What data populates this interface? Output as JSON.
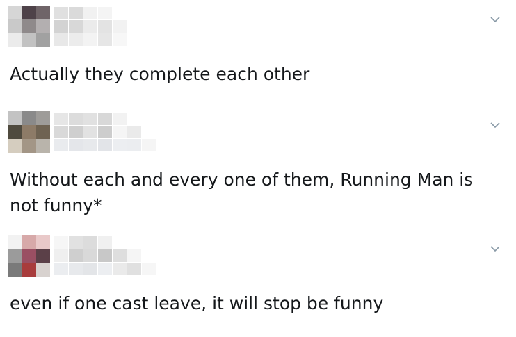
{
  "replies": [
    {
      "text": "Actually they complete each other",
      "avatar_colors": [
        "#d6d6d6",
        "#4e4249",
        "#6f6468",
        "#c9c9c9",
        "#8f8a8b",
        "#b3afb0",
        "#ebebeb",
        "#c2c2c2",
        "#a1a1a1"
      ],
      "name_colors": [
        "#e0e0e0",
        "#dadada",
        "#f1f1f1",
        "#f4f4f4",
        "#ffffff",
        "#d3d3d3",
        "#d8d8d8",
        "#ebebeb",
        "#e3e3e3",
        "#f2f2f2",
        "#e8e8e8",
        "#ececec",
        "#f3f3f3",
        "#e6e6e6",
        "#f7f7f7"
      ]
    },
    {
      "text": "Without each and every one of them, Running Man is not funny*",
      "avatar_colors": [
        "#c3c3c3",
        "#8a8a8a",
        "#9e9c99",
        "#4f4a3e",
        "#8d7b67",
        "#6f6352",
        "#d5cdbf",
        "#a39686",
        "#b9b4ab"
      ],
      "name_colors": [
        "#e6e6e6",
        "#dcdcdc",
        "#e1e1e1",
        "#d8d8d8",
        "#f2f2f2",
        "#ffffff",
        "#ffffff",
        "#d9d9d9",
        "#cfcfcf",
        "#e2e2e2",
        "#cdcdcd",
        "#f5f5f5",
        "#eaeaea",
        "#ffffff",
        "#e9ebee",
        "#e4e6ea",
        "#e7e9ec",
        "#e2e4e8",
        "#eceef1",
        "#ebedf0",
        "#f5f5f5"
      ]
    },
    {
      "text": "even if one cast leave, it will stop be funny",
      "avatar_colors": [
        "#f2f2f2",
        "#d7a9a9",
        "#e9c9c9",
        "#9b9b9b",
        "#9a4f63",
        "#5b4048",
        "#7a7a7a",
        "#a83c3c",
        "#d8d2cf"
      ],
      "name_colors": [
        "#f6f6f6",
        "#e1e1e1",
        "#dcdcdc",
        "#f0f0f0",
        "#ffffff",
        "#ffffff",
        "#ffffff",
        "#efefef",
        "#cfcfcf",
        "#d9d9d9",
        "#c8c8c8",
        "#dedede",
        "#f5f5f5",
        "#ffffff",
        "#ebedf0",
        "#e7e9ec",
        "#e3e5e8",
        "#eceef1",
        "#eaeaea",
        "#e0e0e0",
        "#f6f6f6"
      ]
    }
  ],
  "icons": {
    "menu": "chevron-down-icon"
  },
  "colors": {
    "text": "#14171a",
    "icon": "#8899a6",
    "background": "#ffffff"
  }
}
